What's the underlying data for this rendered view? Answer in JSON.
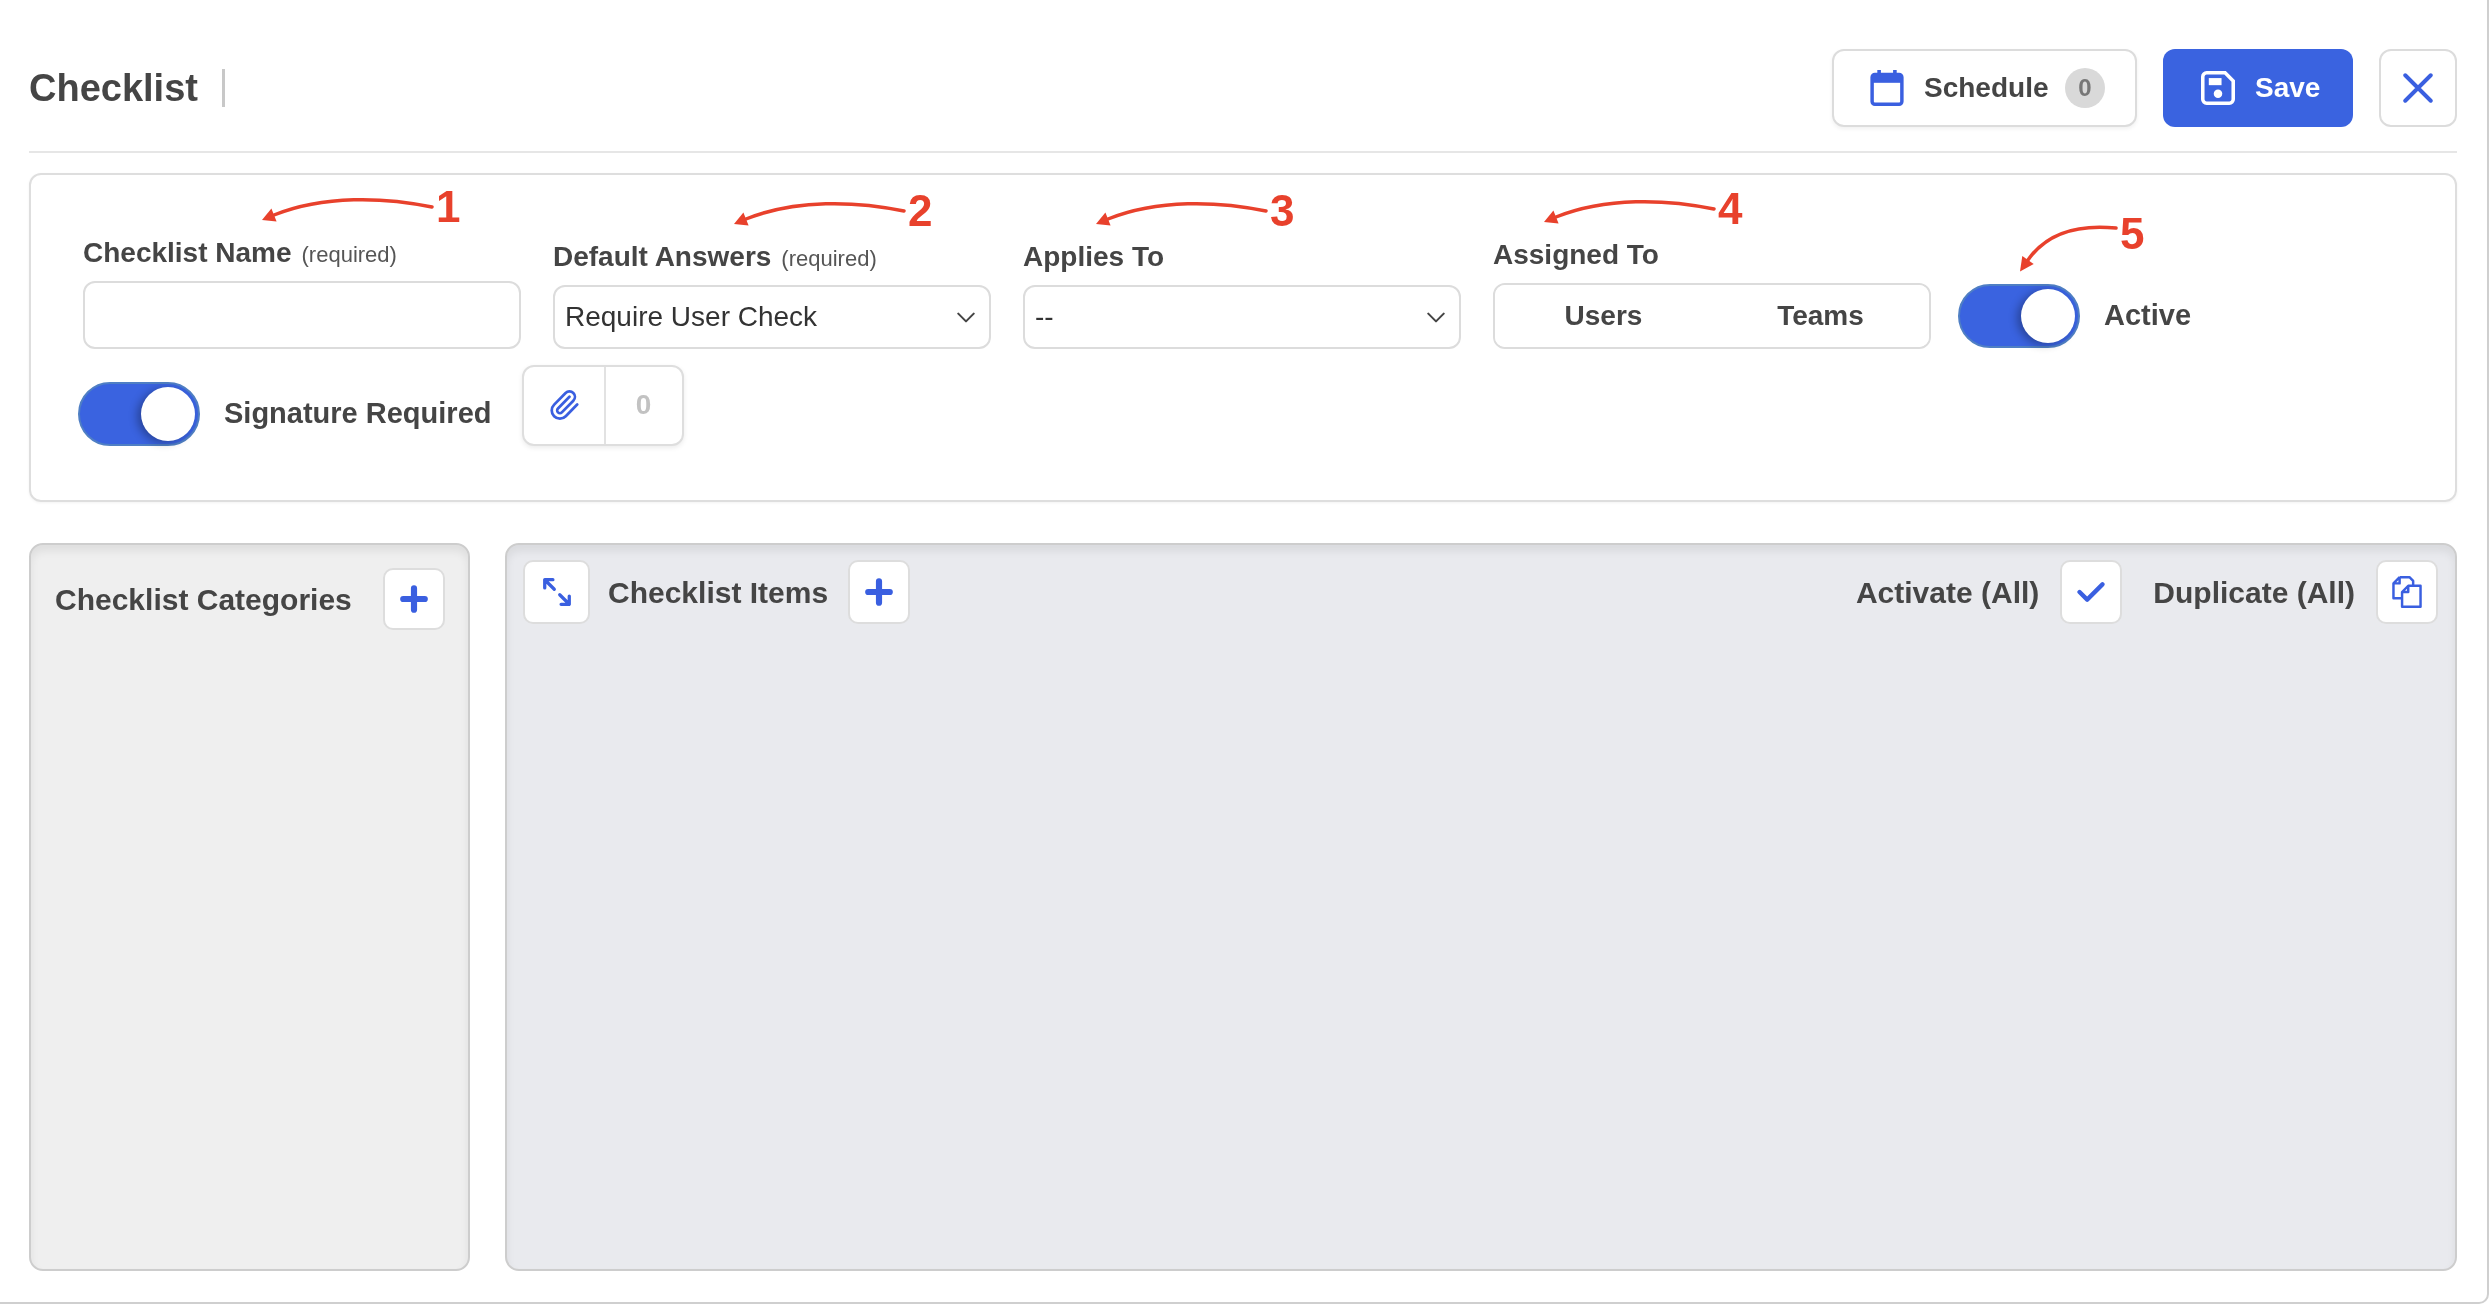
{
  "header": {
    "title": "Checklist",
    "schedule": {
      "label": "Schedule",
      "count": "0"
    },
    "save": {
      "label": "Save"
    }
  },
  "form": {
    "fields": [
      {
        "kind": "text",
        "label": "Checklist Name",
        "note": "(required)",
        "annotation": "1"
      },
      {
        "kind": "select",
        "label": "Default Answers",
        "note": "(required)",
        "value": "Require User Check",
        "annotation": "2"
      },
      {
        "kind": "select",
        "label": "Applies To",
        "value": "--",
        "annotation": "3"
      },
      {
        "kind": "segmented",
        "label": "Assigned To",
        "options": [
          {
            "label": "Users",
            "selected": false
          },
          {
            "label": "Teams",
            "selected": false
          }
        ],
        "annotation": "4"
      }
    ],
    "active": {
      "label": "Active",
      "on": true,
      "annotation": "5"
    },
    "signature": {
      "label": "Signature Required",
      "on": true
    },
    "attachments": {
      "count": "0"
    }
  },
  "categories": {
    "title": "Checklist Categories"
  },
  "items": {
    "title": "Checklist Items",
    "actions": [
      {
        "kind": "activate",
        "label": "Activate (All)"
      },
      {
        "kind": "duplicate",
        "label": "Duplicate (All)"
      }
    ]
  }
}
